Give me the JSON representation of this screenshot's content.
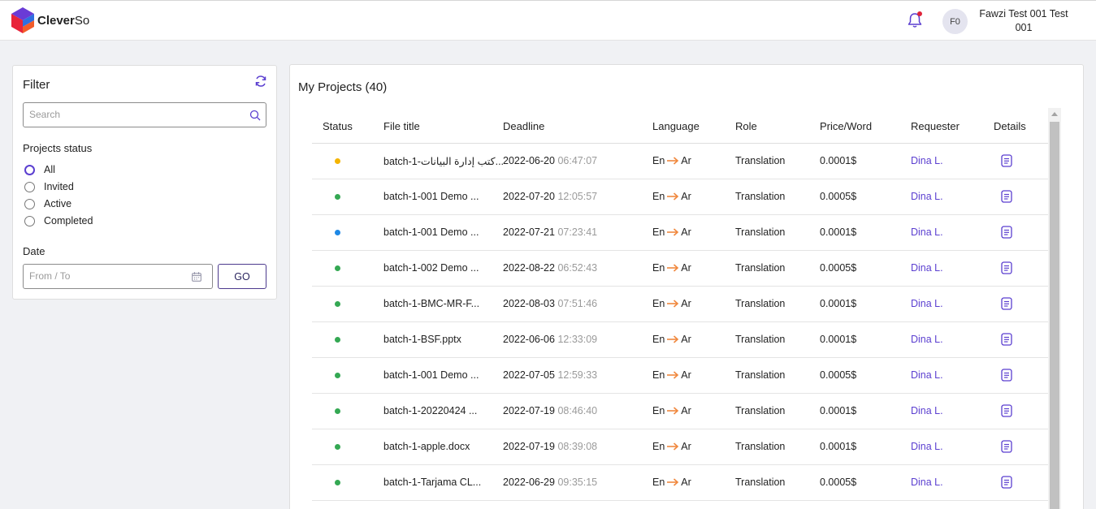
{
  "app": {
    "brand_bold": "Clever",
    "brand_rest": "So"
  },
  "header": {
    "avatar_initials": "F0",
    "username": "Fawzi Test 001 Test 001"
  },
  "filter": {
    "title": "Filter",
    "search_placeholder": "Search",
    "status_label": "Projects status",
    "options": [
      "All",
      "Invited",
      "Active",
      "Completed"
    ],
    "selected_option": "All",
    "date_label": "Date",
    "date_placeholder": "From / To",
    "go_label": "GO"
  },
  "projects": {
    "title": "My Projects (40)",
    "columns": [
      "Status",
      "File title",
      "Deadline",
      "Language",
      "Role",
      "Price/Word",
      "Requester",
      "Details"
    ],
    "rows": [
      {
        "status_color": "#f4b400",
        "file": "batch-1-ﻛﺘﺐ إدارة اﻟﺒﻴﺎﻧﺎت...",
        "date": "2022-06-20",
        "time": "06:47:07",
        "src": "En",
        "tgt": "Ar",
        "role": "Translation",
        "price": "0.0001$",
        "requester": "Dina L."
      },
      {
        "status_color": "#34a853",
        "file": "batch-1-001 Demo ...",
        "date": "2022-07-20",
        "time": "12:05:57",
        "src": "En",
        "tgt": "Ar",
        "role": "Translation",
        "price": "0.0005$",
        "requester": "Dina L."
      },
      {
        "status_color": "#1e88e5",
        "file": "batch-1-001 Demo ...",
        "date": "2022-07-21",
        "time": "07:23:41",
        "src": "En",
        "tgt": "Ar",
        "role": "Translation",
        "price": "0.0001$",
        "requester": "Dina L."
      },
      {
        "status_color": "#34a853",
        "file": "batch-1-002 Demo ...",
        "date": "2022-08-22",
        "time": "06:52:43",
        "src": "En",
        "tgt": "Ar",
        "role": "Translation",
        "price": "0.0005$",
        "requester": "Dina L."
      },
      {
        "status_color": "#34a853",
        "file": "batch-1-BMC-MR-F...",
        "date": "2022-08-03",
        "time": "07:51:46",
        "src": "En",
        "tgt": "Ar",
        "role": "Translation",
        "price": "0.0001$",
        "requester": "Dina L."
      },
      {
        "status_color": "#34a853",
        "file": "batch-1-BSF.pptx",
        "date": "2022-06-06",
        "time": "12:33:09",
        "src": "En",
        "tgt": "Ar",
        "role": "Translation",
        "price": "0.0001$",
        "requester": "Dina L."
      },
      {
        "status_color": "#34a853",
        "file": "batch-1-001 Demo ...",
        "date": "2022-07-05",
        "time": "12:59:33",
        "src": "En",
        "tgt": "Ar",
        "role": "Translation",
        "price": "0.0005$",
        "requester": "Dina L."
      },
      {
        "status_color": "#34a853",
        "file": "batch-1-20220424 ...",
        "date": "2022-07-19",
        "time": "08:46:40",
        "src": "En",
        "tgt": "Ar",
        "role": "Translation",
        "price": "0.0001$",
        "requester": "Dina L."
      },
      {
        "status_color": "#34a853",
        "file": "batch-1-apple.docx",
        "date": "2022-07-19",
        "time": "08:39:08",
        "src": "En",
        "tgt": "Ar",
        "role": "Translation",
        "price": "0.0001$",
        "requester": "Dina L."
      },
      {
        "status_color": "#34a853",
        "file": "batch-1-Tarjama CL...",
        "date": "2022-06-29",
        "time": "09:35:15",
        "src": "En",
        "tgt": "Ar",
        "role": "Translation",
        "price": "0.0005$",
        "requester": "Dina L."
      }
    ]
  },
  "colors": {
    "accent": "#5b3fd0",
    "arrow": "#f0883e"
  },
  "icons": {
    "bell": "bell-icon",
    "refresh": "refresh-icon",
    "search": "search-icon",
    "calendar": "calendar-icon",
    "details": "document-icon",
    "arrow": "arrow-right-icon"
  }
}
